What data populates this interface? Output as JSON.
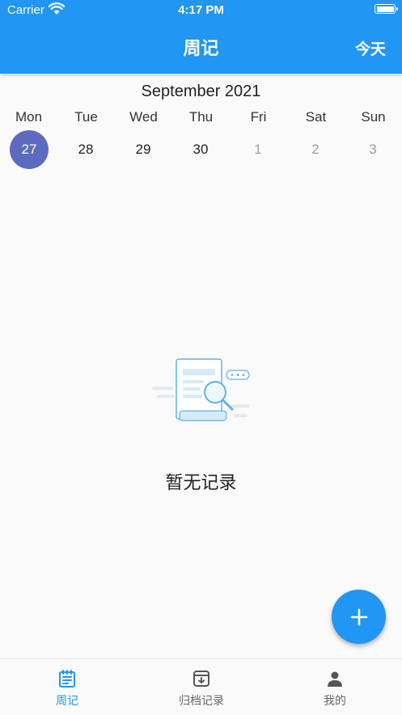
{
  "status_bar": {
    "carrier": "Carrier",
    "time": "4:17 PM"
  },
  "appbar": {
    "title": "周记",
    "today": "今天"
  },
  "calendar": {
    "month": "September 2021",
    "weekdays": [
      "Mon",
      "Tue",
      "Wed",
      "Thu",
      "Fri",
      "Sat",
      "Sun"
    ],
    "days": [
      "27",
      "28",
      "29",
      "30",
      "1",
      "2",
      "3"
    ],
    "selected_day": "27"
  },
  "empty": {
    "text": "暂无记录"
  },
  "fab": {
    "icon": "plus-icon"
  },
  "colors": {
    "primary": "#2196f3",
    "selected": "#5c6bc0"
  },
  "bottom_nav": [
    {
      "label": "周记",
      "icon": "journal-icon",
      "active": true
    },
    {
      "label": "归档记录",
      "icon": "archive-icon",
      "active": false
    },
    {
      "label": "我的",
      "icon": "person-icon",
      "active": false
    }
  ]
}
